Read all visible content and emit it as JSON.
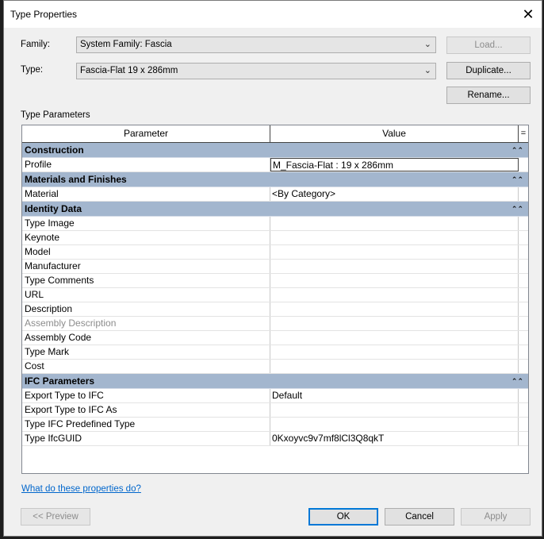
{
  "window": {
    "title": "Type Properties"
  },
  "family": {
    "label": "Family:",
    "value": "System Family: Fascia"
  },
  "type": {
    "label": "Type:",
    "value": "Fascia-Flat 19 x 286mm"
  },
  "buttons": {
    "load": "Load...",
    "duplicate": "Duplicate...",
    "rename": "Rename...",
    "preview": "<< Preview",
    "ok": "OK",
    "cancel": "Cancel",
    "apply": "Apply"
  },
  "type_parameters_label": "Type Parameters",
  "grid": {
    "col_parameter": "Parameter",
    "col_value": "Value",
    "col_extra": "="
  },
  "groups": [
    {
      "name": "Construction",
      "rows": [
        {
          "name": "Profile",
          "value": "M_Fascia-Flat : 19 x 286mm"
        }
      ]
    },
    {
      "name": "Materials and Finishes",
      "rows": [
        {
          "name": "Material",
          "value": "<By Category>"
        }
      ]
    },
    {
      "name": "Identity Data",
      "rows": [
        {
          "name": "Type Image",
          "value": ""
        },
        {
          "name": "Keynote",
          "value": ""
        },
        {
          "name": "Model",
          "value": ""
        },
        {
          "name": "Manufacturer",
          "value": ""
        },
        {
          "name": "Type Comments",
          "value": ""
        },
        {
          "name": "URL",
          "value": ""
        },
        {
          "name": "Description",
          "value": ""
        },
        {
          "name": "Assembly Description",
          "value": ""
        },
        {
          "name": "Assembly Code",
          "value": ""
        },
        {
          "name": "Type Mark",
          "value": ""
        },
        {
          "name": "Cost",
          "value": ""
        }
      ]
    },
    {
      "name": "IFC Parameters",
      "rows": [
        {
          "name": "Export Type to IFC",
          "value": "Default"
        },
        {
          "name": "Export Type to IFC As",
          "value": ""
        },
        {
          "name": "Type IFC Predefined Type",
          "value": ""
        },
        {
          "name": "Type IfcGUID",
          "value": "0Kxoyvc9v7mf8lCl3Q8qkT"
        }
      ]
    }
  ],
  "help_link": "What do these properties do?"
}
